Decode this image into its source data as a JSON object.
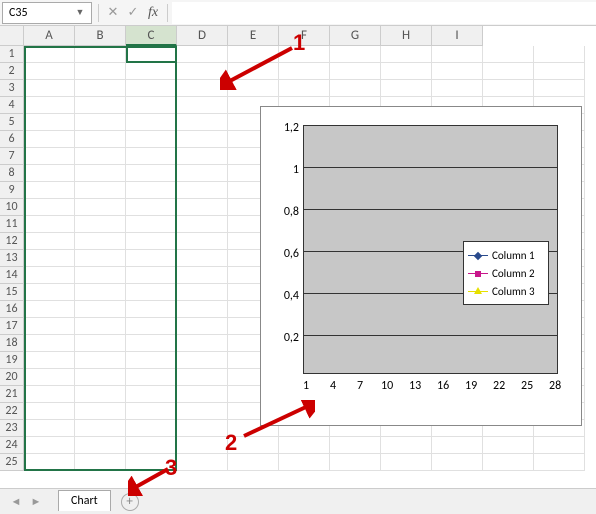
{
  "formula_bar": {
    "name_box": "C35",
    "cancel": "✕",
    "confirm": "✓",
    "fx": "fx"
  },
  "columns": [
    "A",
    "B",
    "C",
    "D",
    "E",
    "F",
    "G",
    "H",
    "I"
  ],
  "rows": [
    "1",
    "2",
    "3",
    "4",
    "5",
    "6",
    "7",
    "8",
    "9",
    "10",
    "11",
    "12",
    "13",
    "14",
    "15",
    "16",
    "17",
    "18",
    "19",
    "20",
    "21",
    "22",
    "23",
    "24",
    "25"
  ],
  "chart_data": {
    "type": "line",
    "x": [
      1,
      4,
      7,
      10,
      13,
      16,
      19,
      22,
      25,
      28
    ],
    "ylim": [
      0,
      1.2
    ],
    "y_ticks": [
      "1,2",
      "1",
      "0,8",
      "0,6",
      "0,4",
      "0,2"
    ],
    "series": [
      {
        "name": "Column 1",
        "color": "#2a4b8d",
        "marker": "diamond",
        "values": []
      },
      {
        "name": "Column 2",
        "color": "#c8178b",
        "marker": "square",
        "values": []
      },
      {
        "name": "Column 3",
        "color": "#e6e000",
        "marker": "triangle",
        "values": []
      }
    ]
  },
  "annotations": {
    "a1": "1",
    "a2": "2",
    "a3": "3"
  },
  "tabs": {
    "active": "Chart",
    "add": "+"
  },
  "nav": {
    "first": "◄",
    "prev": "◄",
    "next": "►",
    "last": "►"
  }
}
